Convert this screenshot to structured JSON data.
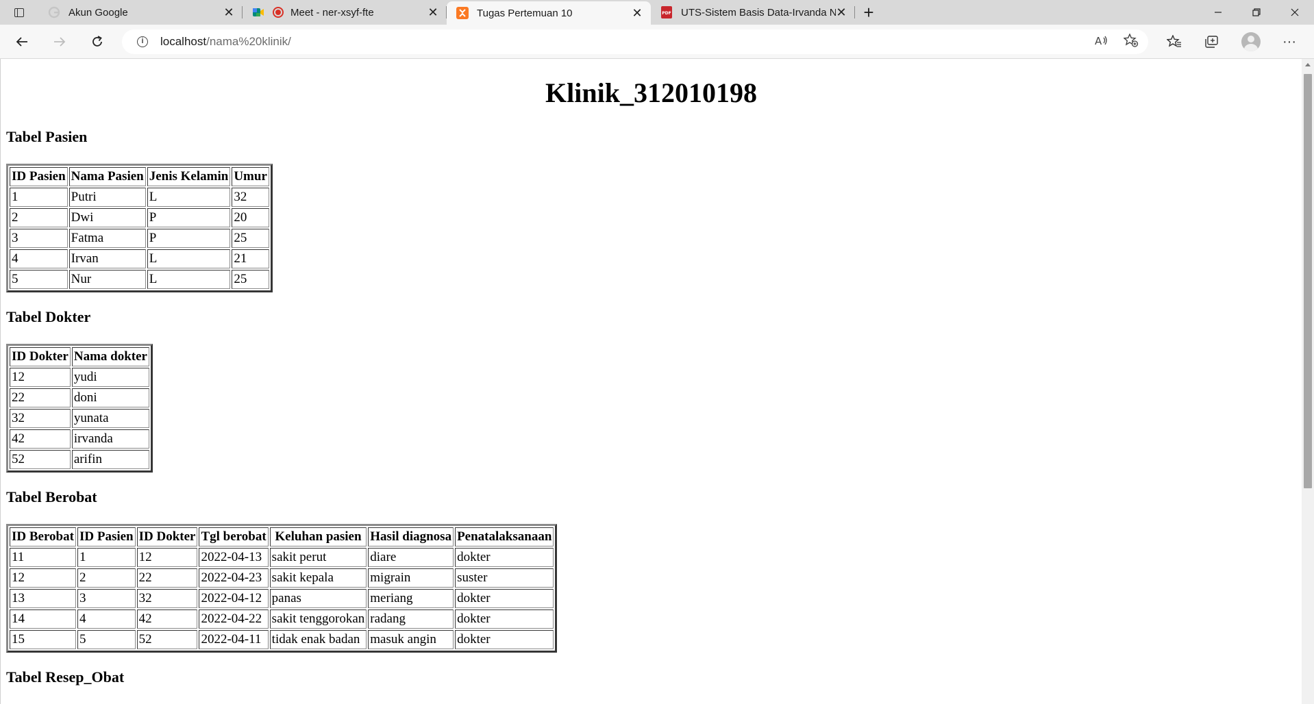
{
  "browser": {
    "tabs": [
      {
        "title": "Akun Google",
        "icon": "google-icon"
      },
      {
        "title": "Meet - ner-xsyf-fte",
        "icon": "google-meet-icon"
      },
      {
        "title": "Tugas Pertemuan 10",
        "icon": "xampp-icon"
      },
      {
        "title": "UTS-Sistem Basis Data-Irvanda N",
        "icon": "pdf-icon"
      }
    ],
    "address": {
      "host": "localhost",
      "path": "/nama%20klinik/"
    }
  },
  "page": {
    "title": "Klinik_312010198",
    "pasien": {
      "heading": "Tabel Pasien",
      "headers": [
        "ID Pasien",
        "Nama Pasien",
        "Jenis Kelamin",
        "Umur"
      ],
      "rows": [
        [
          "1",
          "Putri",
          "L",
          "32"
        ],
        [
          "2",
          "Dwi",
          "P",
          "20"
        ],
        [
          "3",
          "Fatma",
          "P",
          "25"
        ],
        [
          "4",
          "Irvan",
          "L",
          "21"
        ],
        [
          "5",
          "Nur",
          "L",
          "25"
        ]
      ]
    },
    "dokter": {
      "heading": "Tabel Dokter",
      "headers": [
        "ID Dokter",
        "Nama dokter"
      ],
      "rows": [
        [
          "12",
          "yudi"
        ],
        [
          "22",
          "doni"
        ],
        [
          "32",
          "yunata"
        ],
        [
          "42",
          "irvanda"
        ],
        [
          "52",
          "arifin"
        ]
      ]
    },
    "berobat": {
      "heading": "Tabel Berobat",
      "headers": [
        "ID Berobat",
        "ID Pasien",
        "ID Dokter",
        "Tgl berobat",
        "Keluhan pasien",
        "Hasil diagnosa",
        "Penatalaksanaan"
      ],
      "rows": [
        [
          "11",
          "1",
          "12",
          "2022-04-13",
          "sakit perut",
          "diare",
          "dokter"
        ],
        [
          "12",
          "2",
          "22",
          "2022-04-23",
          "sakit kepala",
          "migrain",
          "suster"
        ],
        [
          "13",
          "3",
          "32",
          "2022-04-12",
          "panas",
          "meriang",
          "dokter"
        ],
        [
          "14",
          "4",
          "42",
          "2022-04-22",
          "sakit tenggorokan",
          "radang",
          "dokter"
        ],
        [
          "15",
          "5",
          "52",
          "2022-04-11",
          "tidak enak badan",
          "masuk angin",
          "dokter"
        ]
      ]
    },
    "resep": {
      "heading": "Tabel Resep_Obat"
    }
  }
}
